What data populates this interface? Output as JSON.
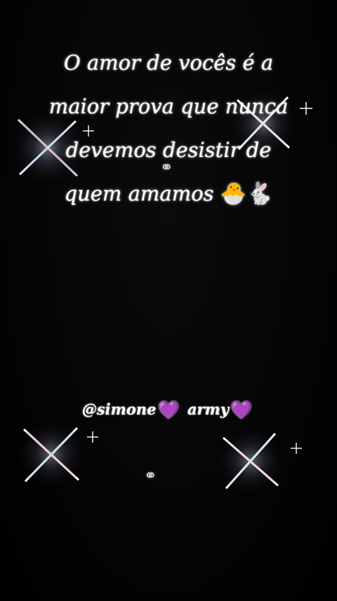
{
  "quote": {
    "lines": [
      "O amor de vocês é a",
      "maior prova que nunca",
      "devemos desistir de",
      "quem amamos"
    ],
    "emojis": [
      "🐣",
      "🐇"
    ]
  },
  "credit": {
    "handle": "@simone",
    "word": "army",
    "heart": "💜",
    "heart_color": "#9b3cf0"
  },
  "decor": {
    "rings": "⚭",
    "sparkle_icon": "sparkle-star-icon"
  }
}
